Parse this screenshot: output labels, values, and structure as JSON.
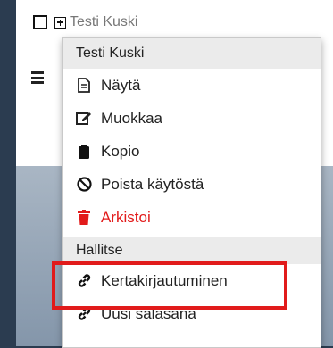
{
  "background": {
    "user_name": "Testi Kuski"
  },
  "menu": {
    "header": "Testi Kuski",
    "items": [
      {
        "label": "Näytä",
        "icon": "document-icon"
      },
      {
        "label": "Muokkaa",
        "icon": "edit-icon"
      },
      {
        "label": "Kopio",
        "icon": "clipboard-icon"
      },
      {
        "label": "Poista käytöstä",
        "icon": "ban-icon"
      },
      {
        "label": "Arkistoi",
        "icon": "trash-icon",
        "color": "#e21b1b"
      }
    ],
    "section_title": "Hallitse",
    "manage_items": [
      {
        "label": "Kertakirjautuminen",
        "icon": "link-icon"
      },
      {
        "label": "Uusi salasana",
        "icon": "link-icon"
      }
    ]
  },
  "colors": {
    "highlight": "#e11b1b",
    "danger": "#e21b1b",
    "page_bg": "#2b3c50"
  }
}
